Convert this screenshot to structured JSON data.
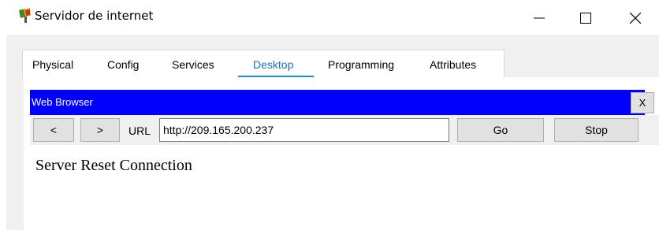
{
  "window": {
    "title": "Servidor de internet",
    "controls": [
      "minimize",
      "maximize",
      "close"
    ]
  },
  "tabs": [
    {
      "label": "Physical",
      "active": false
    },
    {
      "label": "Config",
      "active": false
    },
    {
      "label": "Services",
      "active": false
    },
    {
      "label": "Desktop",
      "active": true
    },
    {
      "label": "Programming",
      "active": false
    },
    {
      "label": "Attributes",
      "active": false
    }
  ],
  "web_browser": {
    "title": "Web Browser",
    "close_label": "X",
    "back_label": "<",
    "forward_label": ">",
    "url_label": "URL",
    "url_value": "http://209.165.200.237",
    "go_label": "Go",
    "stop_label": "Stop",
    "page_text": "Server Reset Connection"
  },
  "colors": {
    "browser_header": "#0000ff",
    "active_tab": "#1a6fc9"
  }
}
